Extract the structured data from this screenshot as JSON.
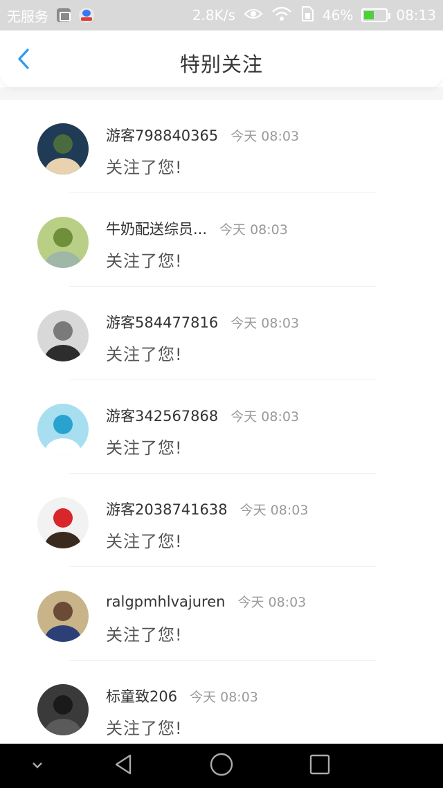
{
  "status_bar": {
    "carrier": "无服务",
    "speed": "2.8K/s",
    "battery_percent": "46%",
    "time": "08:13",
    "battery_level": 0.46,
    "icons": [
      "image-icon",
      "baidu-icon",
      "eye-icon",
      "wifi-icon",
      "sim-icon",
      "battery-icon"
    ]
  },
  "header": {
    "title": "特别关注",
    "back_icon": "chevron-left-icon",
    "accent_color": "#2b9af3"
  },
  "list": {
    "items": [
      {
        "name": "游客798840365",
        "time": "今天 08:03",
        "message": "关注了您!",
        "avatar_colors": [
          "#1f3b55",
          "#4a6b3d",
          "#e8d2b0"
        ]
      },
      {
        "name": "牛奶配送综员...",
        "time": "今天 08:03",
        "message": "关注了您!",
        "avatar_colors": [
          "#b9cf86",
          "#6f8f3b",
          "#9fb7a7"
        ]
      },
      {
        "name": "游客584477816",
        "time": "今天 08:03",
        "message": "关注了您!",
        "avatar_colors": [
          "#d8d8d8",
          "#7a7a7a",
          "#2d2d2d"
        ]
      },
      {
        "name": "游客342567868",
        "time": "今天 08:03",
        "message": "关注了您!",
        "avatar_colors": [
          "#a8dff0",
          "#2aa2cf",
          "#ffffff"
        ]
      },
      {
        "name": "游客2038741638",
        "time": "今天 08:03",
        "message": "关注了您!",
        "avatar_colors": [
          "#f2f2f2",
          "#d8262b",
          "#3a2a1e"
        ]
      },
      {
        "name": "ralgpmhlvajuren",
        "time": "今天 08:03",
        "message": "关注了您!",
        "avatar_colors": [
          "#c9b48a",
          "#6b4a36",
          "#2c3f77"
        ]
      },
      {
        "name": "标童致206",
        "time": "今天 08:03",
        "message": "关注了您!",
        "avatar_colors": [
          "#3a3a3a",
          "#1a1a1a",
          "#5a5a5a"
        ]
      }
    ]
  },
  "nav_bar": {
    "buttons": [
      "chevron-down-icon",
      "back-triangle-icon",
      "home-circle-icon",
      "recents-square-icon"
    ]
  }
}
